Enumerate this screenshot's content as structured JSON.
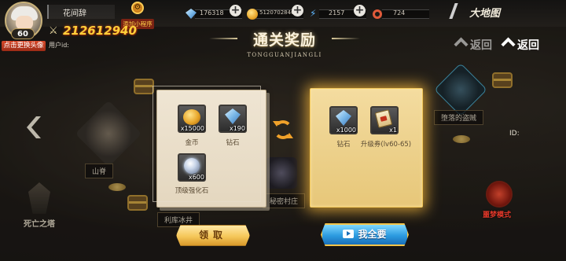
{
  "player": {
    "name": "花间辞",
    "level": "60",
    "change_avatar": "点击更换头像",
    "power": "212612940",
    "user_id_label": "用户id:"
  },
  "mini_program": {
    "label": "添加小程序"
  },
  "resources": [
    {
      "icon": "diamond-icon",
      "value": "176318"
    },
    {
      "icon": "gold-coin-icon",
      "value": "5120702846"
    },
    {
      "icon": "energy-icon",
      "value": "2157"
    },
    {
      "icon": "target-icon",
      "value": "724"
    }
  ],
  "nav": {
    "big_map": "大地图",
    "back": "返回",
    "back_dim": "返回"
  },
  "id_label": "ID:",
  "map_nodes": [
    {
      "name": "山脊"
    },
    {
      "name": "利库冰井"
    },
    {
      "name": "秘密村庄"
    },
    {
      "name": "堕落的盗贼"
    },
    {
      "name": "死亡之塔"
    },
    {
      "name": "噩梦模式"
    }
  ],
  "dialog": {
    "title": "通关奖励",
    "title_pinyin": "TONGGUANJIANGLI",
    "left_rewards": [
      {
        "icon": "gold-coin-icon",
        "qty": "x15000",
        "name": "金币"
      },
      {
        "icon": "diamond-icon",
        "qty": "x190",
        "name": "钻石"
      },
      {
        "icon": "strengthen-stone-icon",
        "qty": "x600",
        "name": "顶级强化石"
      }
    ],
    "right_rewards": [
      {
        "icon": "diamond-icon",
        "qty": "x1000",
        "name": "钻石"
      },
      {
        "icon": "upgrade-ticket-icon",
        "qty": "x1",
        "name": "升级券(lv60-65)"
      }
    ],
    "claim_button": "领取",
    "claim_all_button": "我全要"
  },
  "colors": {
    "gold_text": "#ffcf3a",
    "highlight_glow": "#ffbe3c",
    "nightmare_red": "#e0382a",
    "claim_all_blue": "#2c9be0"
  }
}
